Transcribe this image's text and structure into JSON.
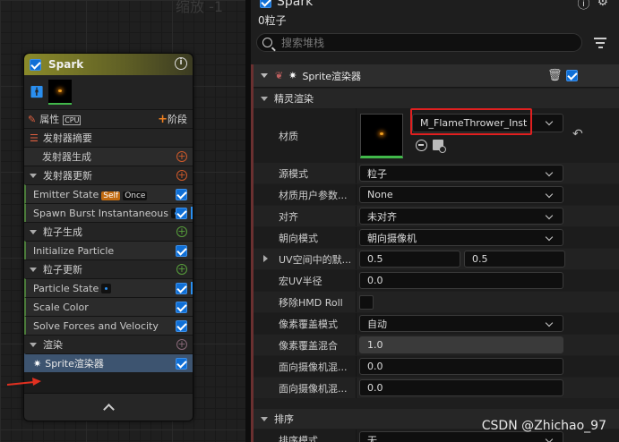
{
  "graph": {
    "zoom_label": "缩放 -1",
    "node": {
      "title": "Spark",
      "rows": {
        "attr_label": "属性",
        "cpu_label": "CPU",
        "stage_label": "阶段",
        "summary_label": "发射器摘要",
        "emitter_spawn": "发射器生成",
        "emitter_update": "发射器更新",
        "emitter_state": "Emitter State",
        "tag_self": "Self",
        "tag_once": "Once",
        "spawn_burst": "Spawn Burst Instantaneous",
        "particle_spawn": "粒子生成",
        "initialize_particle": "Initialize Particle",
        "particle_update": "粒子更新",
        "particle_state": "Particle State",
        "scale_color": "Scale Color",
        "solve_forces": "Solve Forces and Velocity",
        "render": "渲染",
        "sprite_renderer": "Sprite渲染器"
      }
    }
  },
  "details": {
    "title": "Spark",
    "particle_count": "0粒子",
    "search": {
      "placeholder": "搜索堆栈",
      "value": ""
    },
    "section_title": "Sprite渲染器",
    "category_sprite": "精灵渲染",
    "category_sort": "排序",
    "props": {
      "material": {
        "name": "材质",
        "value": "M_FlameThrower_Inst"
      },
      "source_mode": {
        "name": "源模式",
        "value": "粒子"
      },
      "material_user_params": {
        "name": "材质用户参数...",
        "value": "None"
      },
      "alignment": {
        "name": "对齐",
        "value": "未对齐"
      },
      "facing_mode": {
        "name": "朝向模式",
        "value": "朝向摄像机"
      },
      "uv_default": {
        "name": "UV空间中的默...",
        "x": "0.5",
        "y": "0.5"
      },
      "macro_uv_radius": {
        "name": "宏UV半径",
        "value": "0.0"
      },
      "remove_hmd_roll": {
        "name": "移除HMD Roll",
        "checked": false
      },
      "pixel_coverage_mode": {
        "name": "像素覆盖模式",
        "value": "自动"
      },
      "pixel_coverage_blend": {
        "name": "像素覆盖混合",
        "value": "1.0"
      },
      "face_camera_blend_1": {
        "name": "面向摄像机混...",
        "value": "0.0"
      },
      "face_camera_blend_2": {
        "name": "面向摄像机混...",
        "value": "0.0"
      },
      "sort_mode": {
        "name": "排序模式",
        "value": "无"
      }
    }
  },
  "watermark": "CSDN @Zhichao_97",
  "colors": {
    "accent_blue": "#0f6fd6",
    "highlight_red": "#e02020",
    "stage_orange": "#f08020",
    "selected_row": "#3d5470"
  }
}
